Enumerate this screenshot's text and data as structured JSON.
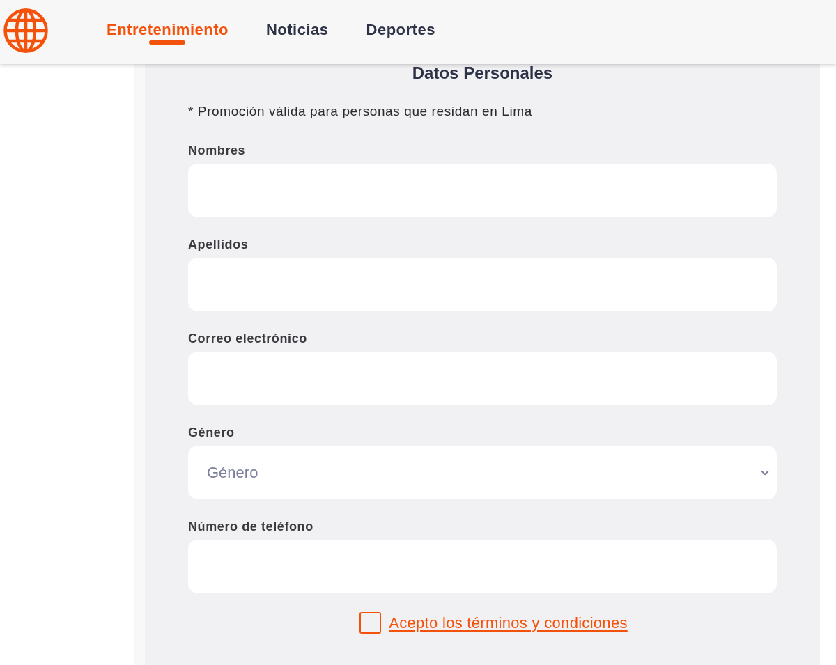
{
  "header": {
    "nav": [
      {
        "label": "Entretenimiento",
        "selected": true
      },
      {
        "label": "Noticias",
        "selected": false
      },
      {
        "label": "Deportes",
        "selected": false
      }
    ]
  },
  "form": {
    "title": "Datos Personales",
    "note": "* Promoción válida para personas que residan en Lima",
    "fields": [
      {
        "kind": "text",
        "label": "Nombres"
      },
      {
        "kind": "text",
        "label": "Apellidos"
      },
      {
        "kind": "text",
        "label": "Correo electrónico"
      },
      {
        "kind": "select",
        "label": "Género",
        "placeholder": "Género"
      },
      {
        "kind": "text",
        "label": "Número de teléfono"
      }
    ],
    "terms": {
      "checked": false,
      "label": "Acepto los términos y condiciones"
    }
  }
}
